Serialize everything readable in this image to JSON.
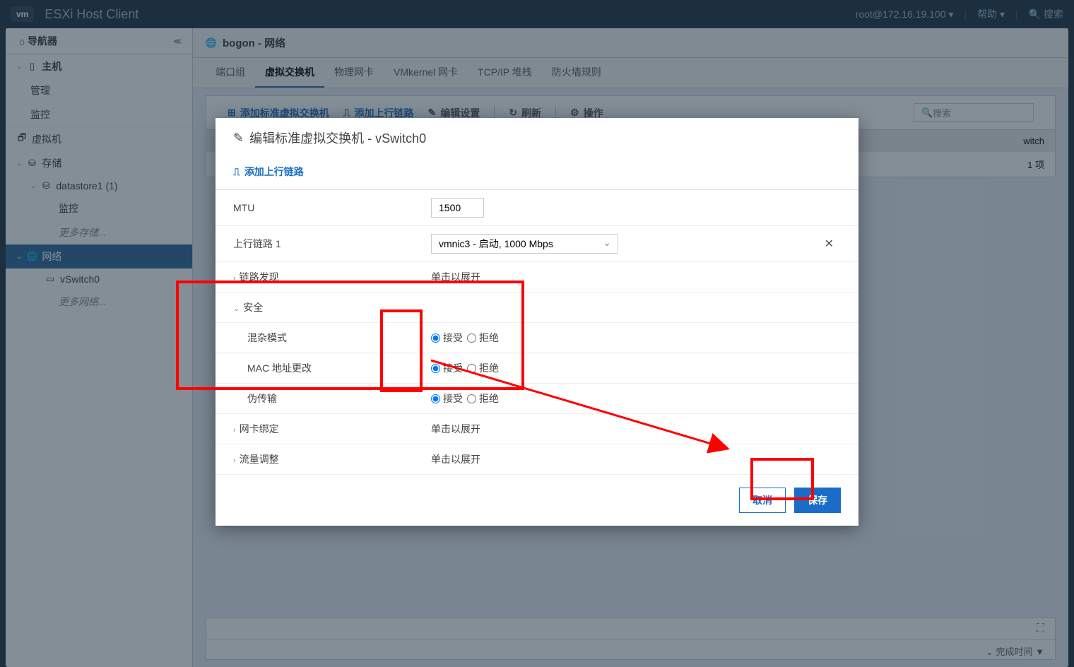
{
  "topbar": {
    "brand": "ESXi Host Client",
    "logo": "vm",
    "user": "root@172.16.19.100 ▾",
    "help": "帮助 ▾",
    "search": "搜索"
  },
  "sidebar": {
    "title": "导航器",
    "host": "主机",
    "manage": "管理",
    "monitor": "监控",
    "vm": "虚拟机",
    "storage": "存储",
    "datastore": "datastore1 (1)",
    "ds_monitor": "监控",
    "ds_more": "更多存储...",
    "network": "网络",
    "vswitch": "vSwitch0",
    "net_more": "更多网络..."
  },
  "content": {
    "title": "bogon - 网络",
    "tabs": {
      "portgroups": "端口组",
      "vswitches": "虚拟交换机",
      "physical": "物理网卡",
      "vmkernel": "VMkernel 网卡",
      "tcpip": "TCP/IP 堆栈",
      "firewall": "防火墙规则"
    },
    "toolbar": {
      "add_vswitch": "添加标准虚拟交换机",
      "add_uplink": "添加上行链路",
      "edit": "编辑设置",
      "refresh": "刷新",
      "actions": "操作",
      "search": "搜索"
    },
    "table": {
      "col_switch": "witch",
      "count": "1 项"
    },
    "bottom": {
      "complete_time": "完成时间 ▼"
    }
  },
  "modal": {
    "title": "编辑标准虚拟交换机 - vSwitch0",
    "add_uplink": "添加上行链路",
    "mtu_label": "MTU",
    "mtu_value": "1500",
    "uplink1_label": "上行链路 1",
    "uplink1_value": "vmnic3 - 启动, 1000 Mbps",
    "link_discovery": "链路发现",
    "click_expand": "单击以展开",
    "security": "安全",
    "promiscuous": "混杂模式",
    "mac_changes": "MAC 地址更改",
    "forged": "伪传输",
    "accept": "接受",
    "reject": "拒绝",
    "nic_teaming": "网卡绑定",
    "traffic_shaping": "流量调整",
    "cancel": "取消",
    "save": "保存"
  }
}
